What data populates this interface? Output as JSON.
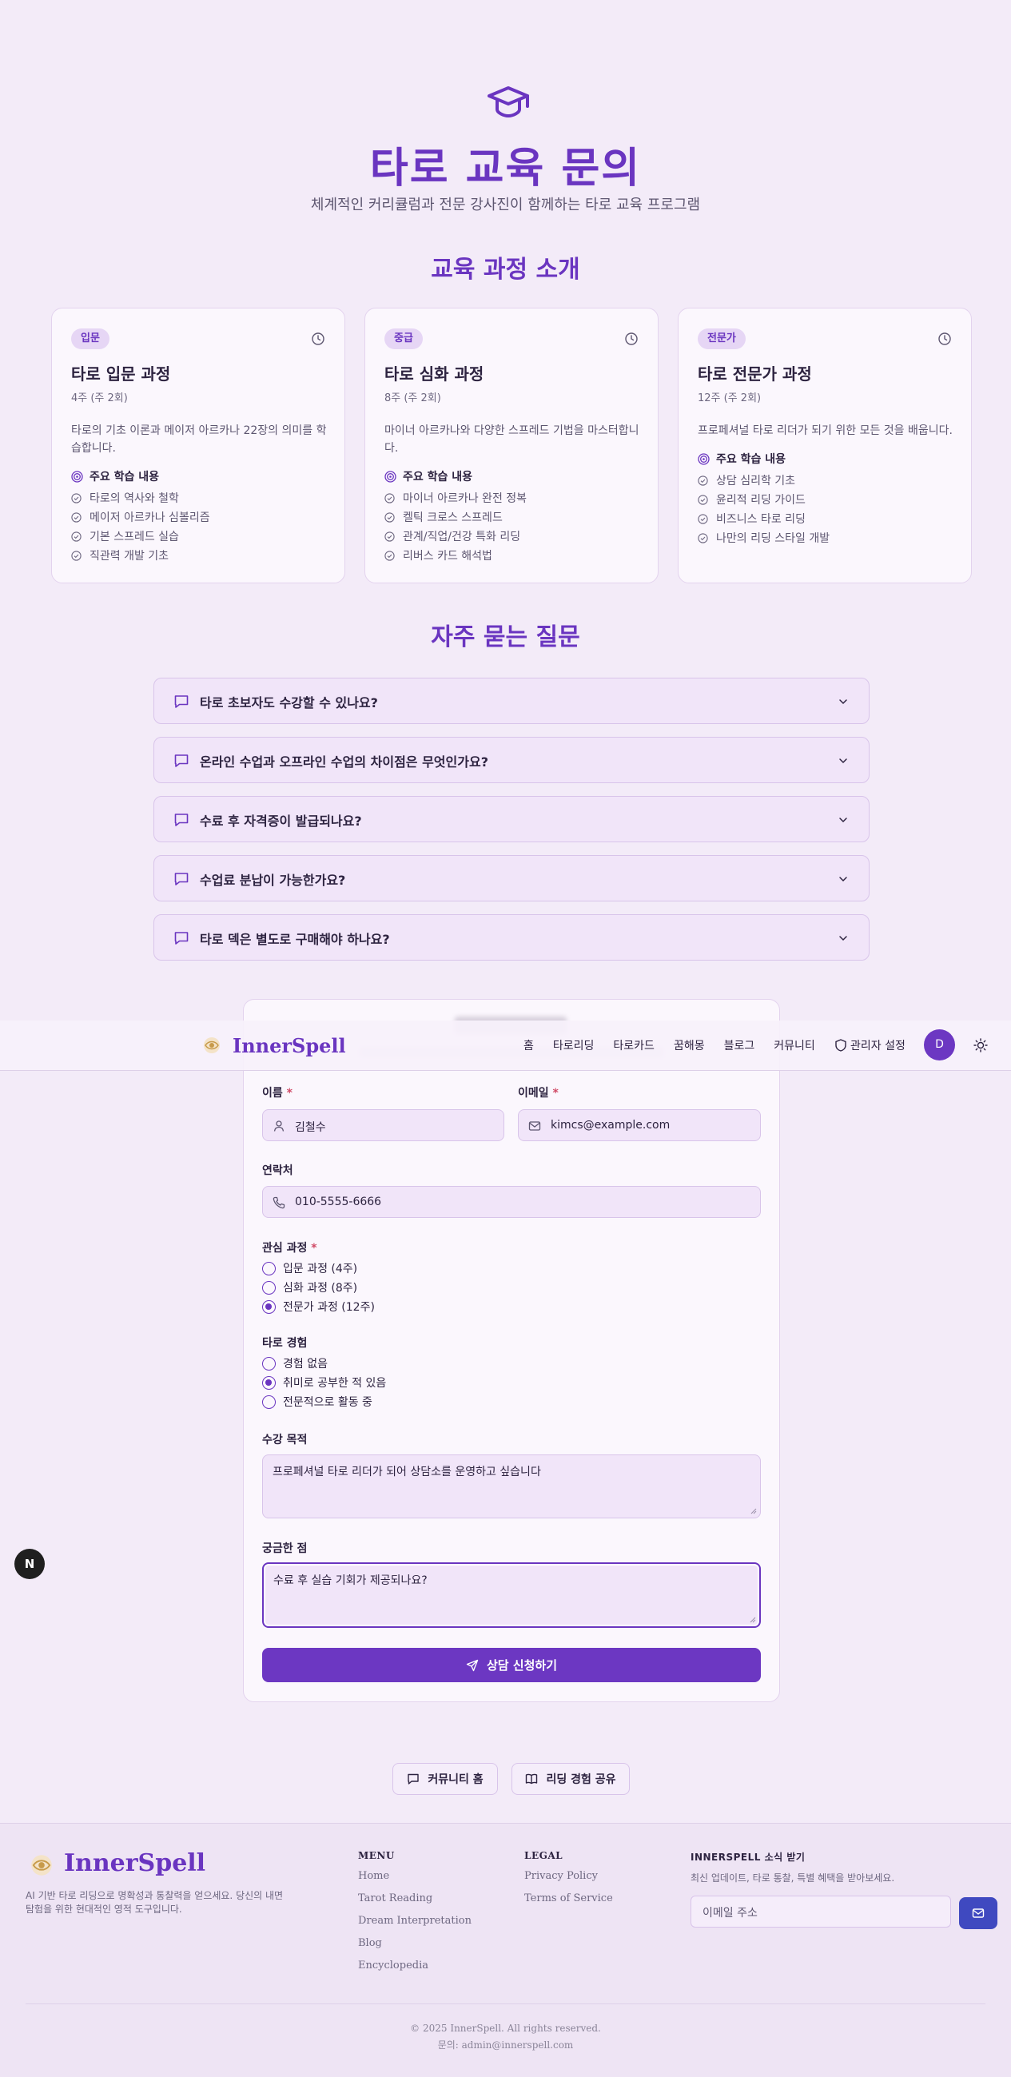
{
  "hero": {
    "title": "타로 교육 문의",
    "subtitle": "체계적인 커리큘럼과 전문 강사진이 함께하는 타로 교육 프로그램"
  },
  "courses_section": {
    "title": "교육 과정 소개",
    "learn_heading": "주요 학습 내용",
    "courses": [
      {
        "badge": "입문",
        "title": "타로 입문 과정",
        "duration": "4주 (주 2회)",
        "description": "타로의 기초 이론과 메이저 아르카나 22장의 의미를 학습합니다.",
        "items": [
          "타로의 역사와 철학",
          "메이저 아르카나 심볼리즘",
          "기본 스프레드 실습",
          "직관력 개발 기초"
        ]
      },
      {
        "badge": "중급",
        "title": "타로 심화 과정",
        "duration": "8주 (주 2회)",
        "description": "마이너 아르카나와 다양한 스프레드 기법을 마스터합니다.",
        "items": [
          "마이너 아르카나 완전 정복",
          "켈틱 크로스 스프레드",
          "관계/직업/건강 특화 리딩",
          "리버스 카드 해석법"
        ]
      },
      {
        "badge": "전문가",
        "title": "타로 전문가 과정",
        "duration": "12주 (주 2회)",
        "description": "프로페셔널 타로 리더가 되기 위한 모든 것을 배웁니다.",
        "items": [
          "상담 심리학 기초",
          "윤리적 리딩 가이드",
          "비즈니스 타로 리딩",
          "나만의 리딩 스타일 개발"
        ]
      }
    ]
  },
  "faq": {
    "title": "자주 묻는 질문",
    "items": [
      "타로 초보자도 수강할 수 있나요?",
      "온라인 수업과 오프라인 수업의 차이점은 무엇인가요?",
      "수료 후 자격증이 발급되나요?",
      "수업료 분납이 가능한가요?",
      "타로 덱은 별도로 구매해야 하나요?"
    ]
  },
  "navbar": {
    "brand": "InnerSpell",
    "items": [
      "홈",
      "타로리딩",
      "타로카드",
      "꿈해몽",
      "블로그",
      "커뮤니티"
    ],
    "admin": "관리자 설정",
    "avatar": "D"
  },
  "form": {
    "name_label": "이름",
    "name_value": "김철수",
    "email_label": "이메일",
    "email_value": "kimcs@example.com",
    "phone_label": "연락처",
    "phone_value": "010-5555-6666",
    "course_label": "관심 과정",
    "course_options": [
      "입문 과정 (4주)",
      "심화 과정 (8주)",
      "전문가 과정 (12주)"
    ],
    "course_selected": 2,
    "exp_label": "타로 경험",
    "exp_options": [
      "경험 없음",
      "취미로 공부한 적 있음",
      "전문적으로 활동 중"
    ],
    "exp_selected": 1,
    "purpose_label": "수강 목적",
    "purpose_value": "프로페셔널 타로 리더가 되어 상담소를 운영하고 싶습니다",
    "question_label": "궁금한 점",
    "question_value": "수료 후 실습 기회가 제공되나요?",
    "submit_label": "상담 신청하기",
    "required_mark": "*"
  },
  "next_badge": "N",
  "bottom_links": {
    "community": "커뮤니티 홈",
    "share": "리딩 경험 공유"
  },
  "footer": {
    "brand": "InnerSpell",
    "description": "AI 기반 타로 리딩으로 명확성과 통찰력을 얻으세요. 당신의 내면 탐험을 위한 현대적인 영적 도구입니다.",
    "menu_heading": "MENU",
    "menu_items": [
      "Home",
      "Tarot Reading",
      "Dream Interpretation",
      "Blog",
      "Encyclopedia"
    ],
    "legal_heading": "LEGAL",
    "legal_items": [
      "Privacy Policy",
      "Terms of Service"
    ],
    "newsletter_heading": "INNERSPELL 소식 받기",
    "newsletter_desc": "최신 업데이트, 타로 통찰, 특별 혜택을 받아보세요.",
    "newsletter_placeholder": "이메일 주소",
    "copyright": "© 2025 InnerSpell. All rights reserved.",
    "contact": "문의: admin@innerspell.com"
  },
  "colors": {
    "primary": "#6a35c0",
    "background": "#f3ebf8",
    "card": "#fbf7fd",
    "newsletter_button": "#3f49c0"
  }
}
